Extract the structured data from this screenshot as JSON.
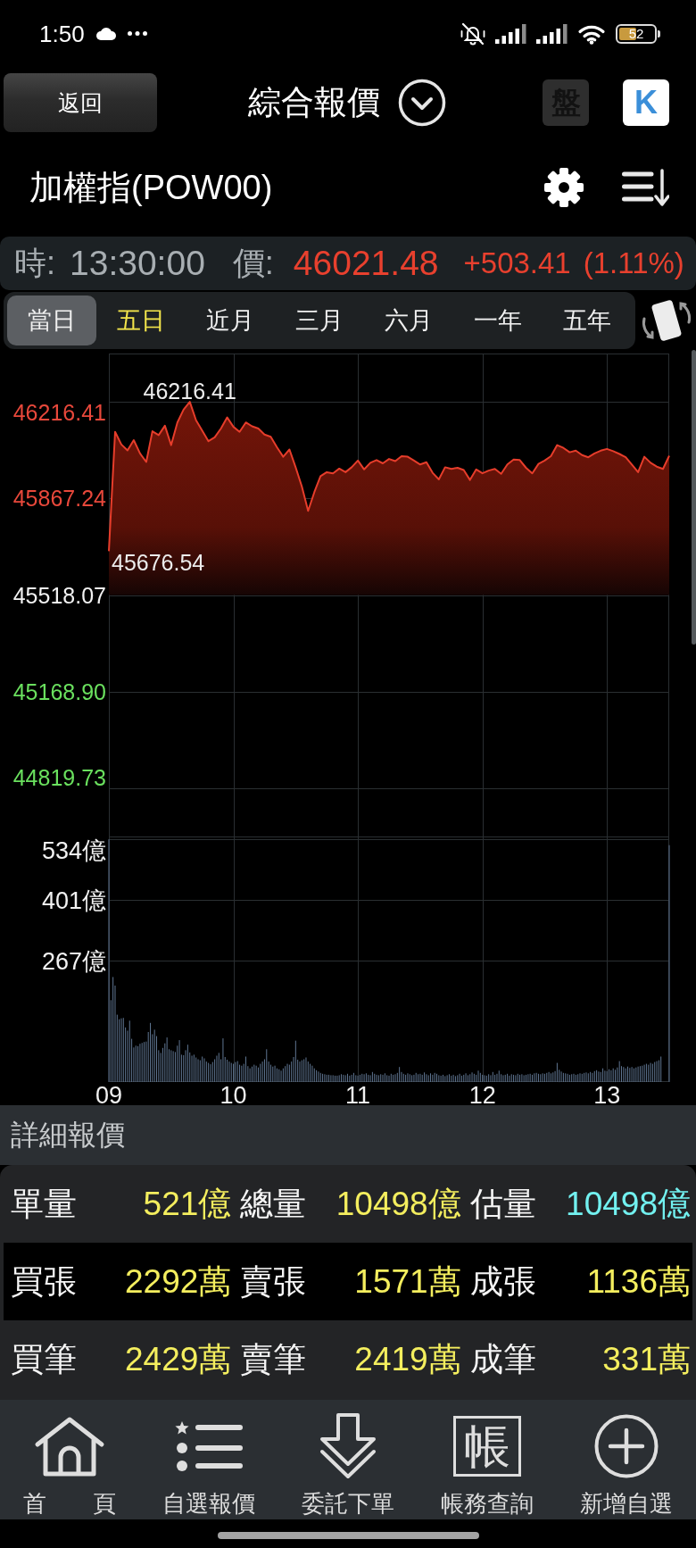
{
  "status_bar": {
    "time": "1:50",
    "battery": "52"
  },
  "header": {
    "back_button": "返回",
    "title": "綜合報價",
    "view_buttons": [
      {
        "label": "盤",
        "disabled": true
      },
      {
        "label": "K",
        "disabled": false
      }
    ]
  },
  "symbol": {
    "name": "加權指(POW00)"
  },
  "quote": {
    "time_label": "時:",
    "time": "13:30:00",
    "price_label": "價:",
    "price": "46021.48",
    "change": "+503.41",
    "change_percent": "(1.11%)",
    "rising": true
  },
  "period_tabs": [
    {
      "label": "當日",
      "selected": true,
      "highlighted": false
    },
    {
      "label": "五日",
      "selected": false,
      "highlighted": true
    },
    {
      "label": "近月",
      "selected": false,
      "highlighted": false
    },
    {
      "label": "三月",
      "selected": false,
      "highlighted": false
    },
    {
      "label": "六月",
      "selected": false,
      "highlighted": false
    },
    {
      "label": "一年",
      "selected": false,
      "highlighted": false
    },
    {
      "label": "五年",
      "selected": false,
      "highlighted": false
    }
  ],
  "price_chart": {
    "chart_data": {
      "type": "area",
      "grid": true,
      "categories": [
        null,
        null,
        null,
        null,
        null,
        null,
        null,
        null,
        null,
        null,
        null,
        null,
        null,
        null,
        null,
        null,
        null,
        null,
        null,
        null,
        null,
        null,
        null,
        null,
        null,
        null,
        null,
        null,
        null,
        null,
        null,
        null,
        null,
        null,
        null,
        null,
        null,
        null,
        null,
        null,
        null,
        null,
        null,
        null,
        null,
        null,
        null,
        null,
        null,
        null,
        null,
        null,
        null,
        null,
        null,
        null,
        null,
        null,
        null,
        null,
        null,
        null,
        null,
        null,
        null,
        null,
        null,
        null,
        null,
        null,
        null,
        null,
        null,
        null,
        null,
        null,
        null,
        null,
        null,
        null,
        null,
        null,
        null,
        null,
        null,
        null,
        null,
        null,
        null,
        null,
        null
      ],
      "series": [
        {
          "color": "#e63d2b",
          "values": [
            45676.54,
            46108,
            46062,
            46041,
            46078,
            46030,
            45999,
            46110,
            46096,
            46130,
            46060,
            46142,
            46188,
            46216.41,
            46150,
            46112,
            46074,
            46088,
            46120,
            46160,
            46126,
            46108,
            46142,
            46128,
            46120,
            46098,
            46090,
            46052,
            46018,
            46044,
            45980,
            45910,
            45822,
            45890,
            45948,
            45962,
            45958,
            45975,
            45962,
            45980,
            46004,
            45972,
            45996,
            46006,
            45994,
            46010,
            46002,
            46020,
            46018,
            46004,
            45990,
            45998,
            45960,
            45936,
            45980,
            45974,
            45978,
            45970,
            45934,
            45972,
            45958,
            45968,
            45974,
            45956,
            45990,
            46008,
            46006,
            45978,
            45958,
            45992,
            46004,
            46020,
            46060,
            46050,
            46034,
            46040,
            46024,
            46016,
            46030,
            46040,
            46046,
            46038,
            46028,
            46016,
            45990,
            45962,
            46018,
            45996,
            45982,
            45974,
            46021.48
          ]
        }
      ],
      "ylim": [
        44645.15,
        46390.99
      ],
      "yticks": [
        {
          "value": 46216.41,
          "label": "46216.41"
        },
        {
          "value": 45867.24,
          "label": "45867.24"
        },
        {
          "value": 45518.07,
          "label": "45518.07"
        },
        {
          "value": 45168.9,
          "label": "45168.90"
        },
        {
          "value": 44819.73,
          "label": "44819.73"
        }
      ],
      "annotations": [
        {
          "y": 46216.41,
          "text": "46216.41"
        },
        "45676.54"
      ]
    }
  },
  "volume_chart": {
    "chart_data": {
      "type": "bar",
      "grid": true,
      "categories": [
        "09",
        null,
        null,
        null,
        null,
        null,
        null,
        null,
        null,
        null,
        null,
        null,
        null,
        null,
        null,
        null,
        null,
        null,
        null,
        null,
        null,
        null,
        null,
        null,
        null,
        null,
        null,
        null,
        null,
        null,
        null,
        null,
        null,
        null,
        null,
        null,
        null,
        null,
        null,
        null,
        null,
        null,
        null,
        null,
        null,
        null,
        null,
        null,
        null,
        null,
        null,
        null,
        null,
        null,
        null,
        null,
        null,
        null,
        null,
        null,
        "10",
        null,
        null,
        null,
        null,
        null,
        null,
        null,
        null,
        null,
        null,
        null,
        null,
        null,
        null,
        null,
        null,
        null,
        null,
        null,
        null,
        null,
        null,
        null,
        null,
        null,
        null,
        null,
        null,
        null,
        null,
        null,
        null,
        null,
        null,
        null,
        null,
        null,
        null,
        null,
        null,
        null,
        null,
        null,
        null,
        null,
        null,
        null,
        null,
        null,
        null,
        null,
        null,
        null,
        null,
        null,
        null,
        null,
        null,
        null,
        "11",
        null,
        null,
        null,
        null,
        null,
        null,
        null,
        null,
        null,
        null,
        null,
        null,
        null,
        null,
        null,
        null,
        null,
        null,
        null,
        null,
        null,
        null,
        null,
        null,
        null,
        null,
        null,
        null,
        null,
        null,
        null,
        null,
        null,
        null,
        null,
        null,
        null,
        null,
        null,
        null,
        null,
        null,
        null,
        null,
        null,
        null,
        null,
        null,
        null,
        null,
        null,
        null,
        null,
        null,
        null,
        null,
        null,
        null,
        null,
        "12",
        null,
        null,
        null,
        null,
        null,
        null,
        null,
        null,
        null,
        null,
        null,
        null,
        null,
        null,
        null,
        null,
        null,
        null,
        null,
        null,
        null,
        null,
        null,
        null,
        null,
        null,
        null,
        null,
        null,
        null,
        null,
        null,
        null,
        null,
        null,
        null,
        null,
        null,
        null,
        null,
        null,
        null,
        null,
        null,
        null,
        null,
        null,
        null,
        null,
        null,
        null,
        null,
        null,
        null,
        null,
        null,
        null,
        null,
        null,
        "13",
        null,
        null,
        null,
        null,
        null,
        null,
        null,
        null,
        null,
        null,
        null,
        null,
        null,
        null,
        null,
        null,
        null,
        null,
        null,
        null,
        null,
        null,
        null,
        null,
        null,
        null,
        null,
        null,
        null,
        null
      ],
      "series": [
        {
          "color": "#5f7591",
          "values": [
            534,
            180,
            231,
            212,
            148,
            138,
            140,
            141,
            120,
            113,
            135,
            95,
            76,
            80,
            79,
            84,
            86,
            88,
            89,
            110,
            130,
            105,
            115,
            101,
            70,
            64,
            75,
            85,
            98,
            72,
            70,
            68,
            66,
            80,
            92,
            60,
            59,
            70,
            82,
            65,
            58,
            60,
            54,
            50,
            48,
            56,
            52,
            45,
            42,
            39,
            44,
            50,
            58,
            64,
            50,
            96,
            55,
            49,
            45,
            42,
            40,
            44,
            46,
            38,
            36,
            40,
            56,
            35,
            30,
            34,
            38,
            36,
            32,
            40,
            45,
            50,
            72,
            45,
            38,
            34,
            36,
            30,
            28,
            25,
            30,
            35,
            40,
            38,
            45,
            55,
            91,
            49,
            45,
            48,
            50,
            54,
            45,
            40,
            36,
            30,
            26,
            23,
            20,
            18,
            17,
            16,
            16,
            15,
            15,
            14,
            14,
            15,
            17,
            16,
            15,
            18,
            14,
            16,
            20,
            15,
            14,
            16,
            18,
            17,
            19,
            16,
            15,
            22,
            18,
            16,
            15,
            17,
            16,
            19,
            15,
            14,
            18,
            16,
            17,
            20,
            33,
            22,
            18,
            16,
            19,
            17,
            15,
            16,
            20,
            17,
            18,
            16,
            21,
            17,
            15,
            19,
            16,
            20,
            18,
            15,
            14,
            16,
            13,
            15,
            17,
            14,
            16,
            13,
            15,
            18,
            14,
            16,
            19,
            15,
            17,
            21,
            18,
            16,
            25,
            20,
            16,
            15,
            14,
            17,
            15,
            22,
            16,
            18,
            25,
            17,
            15,
            16,
            18,
            14,
            17,
            16,
            15,
            18,
            16,
            17,
            15,
            16,
            17,
            18,
            16,
            19,
            20,
            18,
            17,
            19,
            18,
            20,
            22,
            19,
            21,
            24,
            42,
            27,
            23,
            20,
            19,
            18,
            16,
            17,
            18,
            16,
            17,
            19,
            18,
            20,
            21,
            19,
            22,
            20,
            24,
            26,
            23,
            22,
            30,
            25,
            24,
            28,
            26,
            30,
            27,
            32,
            46,
            35,
            33,
            30,
            34,
            31,
            33,
            30,
            32,
            34,
            35,
            36,
            38,
            40,
            38,
            42,
            40,
            44,
            46,
            48,
            56,
            null,
            null,
            null,
            521
          ]
        }
      ],
      "ylim": [
        0,
        540
      ],
      "yticks": [
        {
          "value": 267,
          "label": "267億"
        },
        {
          "value": 401,
          "label": "401億"
        },
        {
          "value": 534,
          "label": "534億"
        }
      ]
    }
  },
  "detail_quote": {
    "title": "詳細報價",
    "rows": [
      {
        "items": [
          {
            "label": "單量",
            "value": "521億",
            "color": "#f4ee5e"
          },
          {
            "label": "總量",
            "value": "10498億",
            "color": "#f4ee5e"
          },
          {
            "label": "估量",
            "value": "10498億",
            "color": "#72f1f0"
          }
        ]
      },
      {
        "items": [
          {
            "label": "買張",
            "value": "2292萬",
            "color": "#f4ee5e"
          },
          {
            "label": "賣張",
            "value": "1571萬",
            "color": "#f4ee5e"
          },
          {
            "label": "成張",
            "value": "1136萬",
            "color": "#f4ee5e"
          }
        ]
      },
      {
        "items": [
          {
            "label": "買筆",
            "value": "2429萬",
            "color": "#f4ee5e"
          },
          {
            "label": "賣筆",
            "value": "2419萬",
            "color": "#f4ee5e"
          },
          {
            "label": "成筆",
            "value": "331萬",
            "color": "#f4ee5e"
          }
        ]
      }
    ]
  },
  "bottom_nav": [
    {
      "label": "首　　頁",
      "kind": "home"
    },
    {
      "label": "自選報價",
      "kind": "watchlist"
    },
    {
      "label": "委託下單",
      "kind": "order"
    },
    {
      "label": "帳務查詢",
      "kind": "account",
      "icon_text": "帳"
    },
    {
      "label": "新增自選",
      "kind": "add"
    }
  ]
}
